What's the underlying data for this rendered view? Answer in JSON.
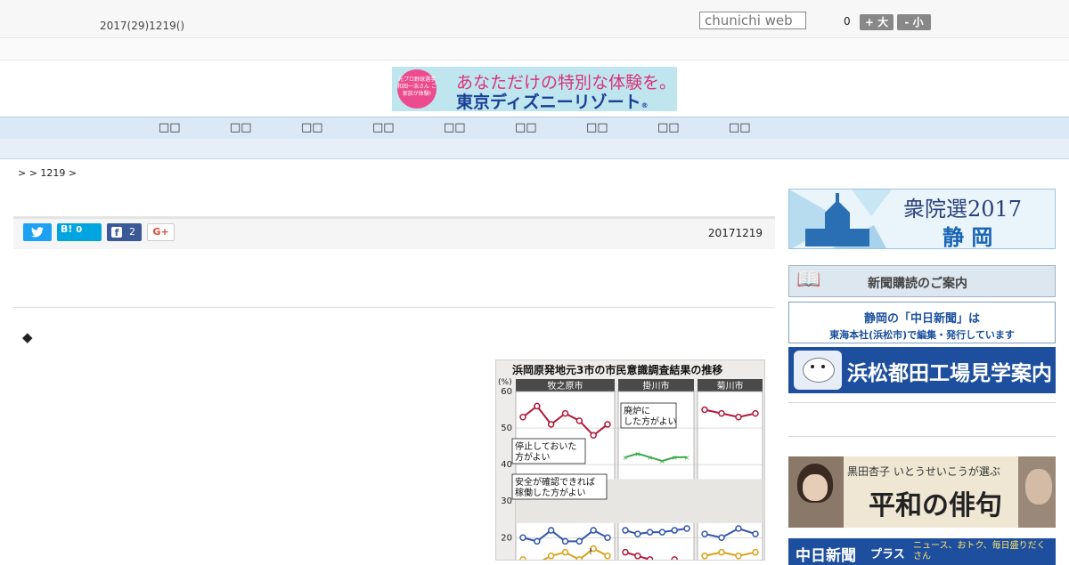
{
  "header": {
    "date": "2017(29)1219()",
    "search_placeholder": "chunichi web",
    "count": "0",
    "font_up": "+ 大",
    "font_down": "- 小"
  },
  "banner": {
    "badge_text": "元プロ野球選手 和田一浩さん ご家族が体験!",
    "line1": "あなただけの特別な体験を。",
    "line2": "東京ディズニーリゾート",
    "mark": "®"
  },
  "nav": {
    "items": [
      "□□",
      "□□",
      "□□",
      "□□",
      "□□",
      "□□",
      "□□",
      "□□",
      "□□"
    ]
  },
  "breadcrumb": ">  > 1219 >",
  "share": {
    "hatena_label": "B!",
    "hatena_count": "0",
    "facebook_count": "2",
    "gplus_label": "G+"
  },
  "article": {
    "date": "20171219",
    "marker": "◆"
  },
  "chart_data": {
    "type": "line",
    "title": "浜岡原発地元3市の市民意識調査結果の推移",
    "ylabel": "(%)",
    "yticks": [
      60,
      50,
      40,
      30,
      20
    ],
    "ylim": [
      13,
      60
    ],
    "panels": [
      "牧之原市",
      "掛川市",
      "菊川市"
    ],
    "annotations": [
      "停止しておいた方がよい",
      "廃炉にした方がよい",
      "安全が確認できれば稼働した方がよい",
      "!"
    ],
    "series": [
      {
        "panel": "牧之原市",
        "values": [
          53,
          56,
          51,
          54,
          52,
          48,
          51
        ],
        "color": "#b0193a"
      },
      {
        "panel": "牧之原市",
        "values": [
          20,
          19,
          22,
          19,
          19,
          22,
          20
        ],
        "color": "#3355aa"
      },
      {
        "panel": "牧之原市",
        "values": [
          14,
          13,
          15,
          16,
          14,
          17,
          15
        ],
        "color": "#d9a21b"
      },
      {
        "panel": "掛川市",
        "values": [
          42,
          43,
          42,
          41,
          42,
          42
        ],
        "color": "#3aa84a"
      },
      {
        "panel": "掛川市",
        "values": [
          22,
          21,
          21.5,
          21.5,
          22,
          22.5
        ],
        "color": "#3355aa"
      },
      {
        "panel": "掛川市",
        "values": [
          16,
          15,
          14,
          13,
          14,
          13
        ],
        "color": "#b0193a"
      },
      {
        "panel": "菊川市",
        "values": [
          55,
          54,
          53,
          54
        ],
        "color": "#b0193a"
      },
      {
        "panel": "菊川市",
        "values": [
          21,
          20,
          22.5,
          21
        ],
        "color": "#3355aa"
      },
      {
        "panel": "菊川市",
        "values": [
          15,
          16,
          15,
          16
        ],
        "color": "#d9a21b"
      }
    ]
  },
  "sidebar": {
    "election_title": "衆院選2017",
    "election_region": "静 岡",
    "subscribe": "新聞購読のご案内",
    "shizuoka_line1": "静岡の「中日新聞」は",
    "shizuoka_line2": "東海本社(浜松市)で編集・発行しています",
    "factory": "浜松都田工場見学案内",
    "haiku_sub": "黒田杏子 いとうせいこうが選ぶ",
    "haiku_title": "平和の俳句",
    "plus_title": "中日新聞",
    "plus_badge": "プラス",
    "plus_sub": "ニュース、おトク、毎日盛りだくさん"
  },
  "colors": {
    "nav_bg": "#dbe8f5",
    "twitter": "#1da1f2",
    "hatena": "#00a4de",
    "facebook": "#3b5998",
    "gplus": "#dd4b39"
  }
}
